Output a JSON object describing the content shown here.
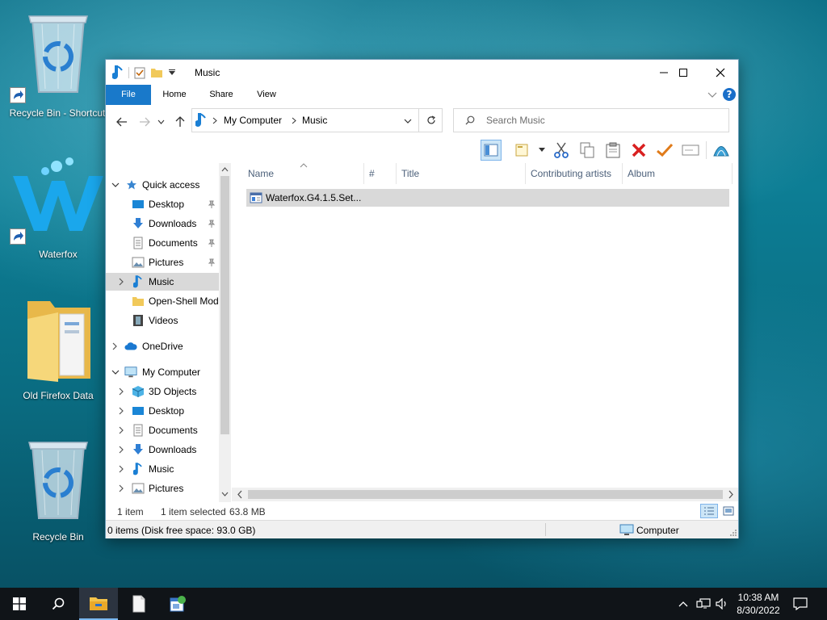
{
  "desktop": {
    "icons": [
      {
        "label": "Recycle Bin - Shortcut"
      },
      {
        "label": "Waterfox"
      },
      {
        "label": "Old Firefox Data"
      },
      {
        "label": "Recycle Bin"
      }
    ]
  },
  "window": {
    "title": "Music",
    "ribbon_tabs": [
      "File",
      "Home",
      "Share",
      "View"
    ],
    "breadcrumb": [
      "My Computer",
      "Music"
    ],
    "search_placeholder": "Search Music",
    "columns": [
      "Name",
      "#",
      "Title",
      "Contributing artists",
      "Album"
    ],
    "files": [
      {
        "name": "Waterfox.G4.1.5.Set..."
      }
    ],
    "nav": {
      "quick_access": "Quick access",
      "quick_items": [
        "Desktop",
        "Downloads",
        "Documents",
        "Pictures",
        "Music",
        "Open-Shell Mod",
        "Videos"
      ],
      "onedrive": "OneDrive",
      "my_computer": "My Computer",
      "computer_items": [
        "3D Objects",
        "Desktop",
        "Documents",
        "Downloads",
        "Music",
        "Pictures"
      ]
    },
    "status": {
      "item_count": "1 item",
      "selection": "1 item selected",
      "size": "63.8 MB"
    },
    "info": {
      "disk": "0 items (Disk free space: 93.0 GB)",
      "location": "Computer"
    }
  },
  "taskbar": {
    "time": "10:38 AM",
    "date": "8/30/2022"
  },
  "colors": {
    "file_tab": "#1979ca",
    "selection": "#d9d9d9",
    "accent_blue": "#0078d7"
  }
}
